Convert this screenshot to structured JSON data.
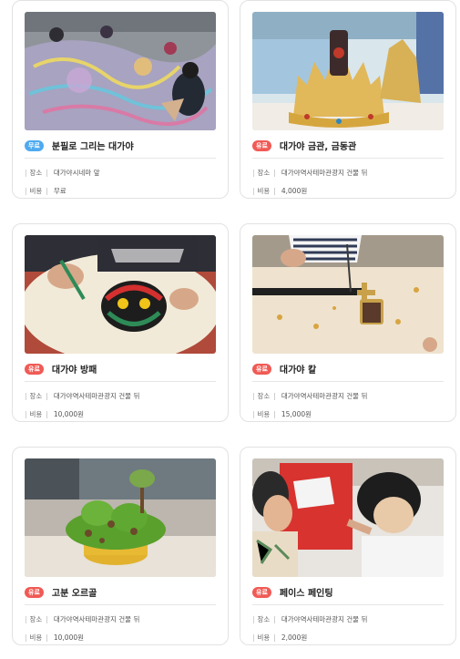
{
  "labels": {
    "location": "장소",
    "cost": "비용"
  },
  "colors": {
    "badge_free": "#4eaaf0",
    "badge_paid": "#f05a55"
  },
  "cards": [
    {
      "badge": "무료",
      "badge_type": "free",
      "title": "분필로 그리는 대가야",
      "location": "대가야시네마 앞",
      "cost": "무료",
      "photo": "chalk-drawing-photo"
    },
    {
      "badge": "유료",
      "badge_type": "paid",
      "title": "대가야 금관, 금동관",
      "location": "대가야역사테마관광지 건물 뒤",
      "cost": "4,000원",
      "photo": "gold-crown-photo"
    },
    {
      "badge": "유료",
      "badge_type": "paid",
      "title": "대가야 방패",
      "location": "대가야역사테마관광지 건물 뒤",
      "cost": "10,000원",
      "photo": "shield-painting-photo"
    },
    {
      "badge": "유료",
      "badge_type": "paid",
      "title": "대가야 칼",
      "location": "대가야역사테마관광지 건물 뒤",
      "cost": "15,000원",
      "photo": "sword-craft-photo"
    },
    {
      "badge": "유료",
      "badge_type": "paid",
      "title": "고분 오르골",
      "location": "대가야역사테마관광지 건물 뒤",
      "cost": "10,000원",
      "photo": "tomb-music-box-photo"
    },
    {
      "badge": "유료",
      "badge_type": "paid",
      "title": "페이스 페인팅",
      "location": "대가야역사테마관광지 건물 뒤",
      "cost": "2,000원",
      "photo": "face-painting-photo"
    }
  ]
}
